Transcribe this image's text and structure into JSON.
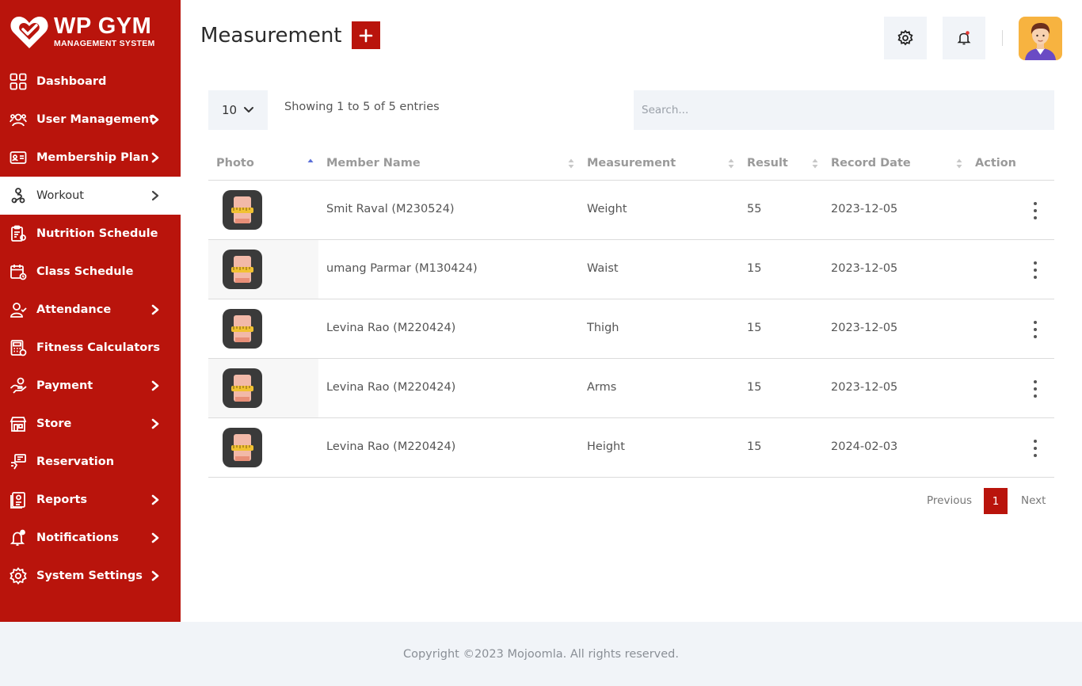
{
  "brand": {
    "title": "WP GYM",
    "subtitle": "MANAGEMENT SYSTEM"
  },
  "sidebar": {
    "items": [
      {
        "label": "Dashboard",
        "icon": "dashboard-icon",
        "has_submenu": false
      },
      {
        "label": "User Management",
        "icon": "users-icon",
        "has_submenu": true
      },
      {
        "label": "Membership Plan",
        "icon": "membership-card-icon",
        "has_submenu": true
      },
      {
        "label": "Workout",
        "icon": "workout-icon",
        "has_submenu": true,
        "active": true
      },
      {
        "label": "Nutrition Schedule",
        "icon": "clipboard-icon",
        "has_submenu": false
      },
      {
        "label": "Class Schedule",
        "icon": "calendar-icon",
        "has_submenu": false
      },
      {
        "label": "Attendance",
        "icon": "user-check-icon",
        "has_submenu": true
      },
      {
        "label": "Fitness Calculators",
        "icon": "calculator-icon",
        "has_submenu": false
      },
      {
        "label": "Payment",
        "icon": "payment-icon",
        "has_submenu": true
      },
      {
        "label": "Store",
        "icon": "store-icon",
        "has_submenu": true
      },
      {
        "label": "Reservation",
        "icon": "reservation-icon",
        "has_submenu": false
      },
      {
        "label": "Reports",
        "icon": "reports-icon",
        "has_submenu": true
      },
      {
        "label": "Notifications",
        "icon": "bell-icon",
        "has_submenu": true
      },
      {
        "label": "System Settings",
        "icon": "gear-icon",
        "has_submenu": true
      }
    ]
  },
  "header": {
    "title": "Measurement",
    "add_icon": "plus-icon",
    "settings_icon": "gear-icon",
    "notification_icon": "bell-icon",
    "avatar_icon": "user-avatar"
  },
  "controls": {
    "page_length": "10",
    "info": "Showing 1 to 5 of 5 entries",
    "search_placeholder": "Search..."
  },
  "table": {
    "columns": [
      "Photo",
      "Member Name",
      "Measurement",
      "Result",
      "Record Date",
      "Action"
    ],
    "rows": [
      {
        "member": "Smit Raval (M230524)",
        "measurement": "Weight",
        "result": "55",
        "date": "2023-12-05"
      },
      {
        "member": "umang Parmar (M130424)",
        "measurement": "Waist",
        "result": "15",
        "date": "2023-12-05"
      },
      {
        "member": "Levina Rao (M220424)",
        "measurement": "Thigh",
        "result": "15",
        "date": "2023-12-05"
      },
      {
        "member": "Levina Rao (M220424)",
        "measurement": "Arms",
        "result": "15",
        "date": "2023-12-05"
      },
      {
        "member": "Levina Rao (M220424)",
        "measurement": "Height",
        "result": "15",
        "date": "2024-02-03"
      }
    ]
  },
  "pagination": {
    "previous": "Previous",
    "current": "1",
    "next": "Next"
  },
  "footer": {
    "copyright": "Copyright ©2023 Mojoomla. All rights reserved."
  },
  "colors": {
    "brand": "#b9140c",
    "panel": "#f1f4f8",
    "avatar_bg": "#f7b340"
  }
}
